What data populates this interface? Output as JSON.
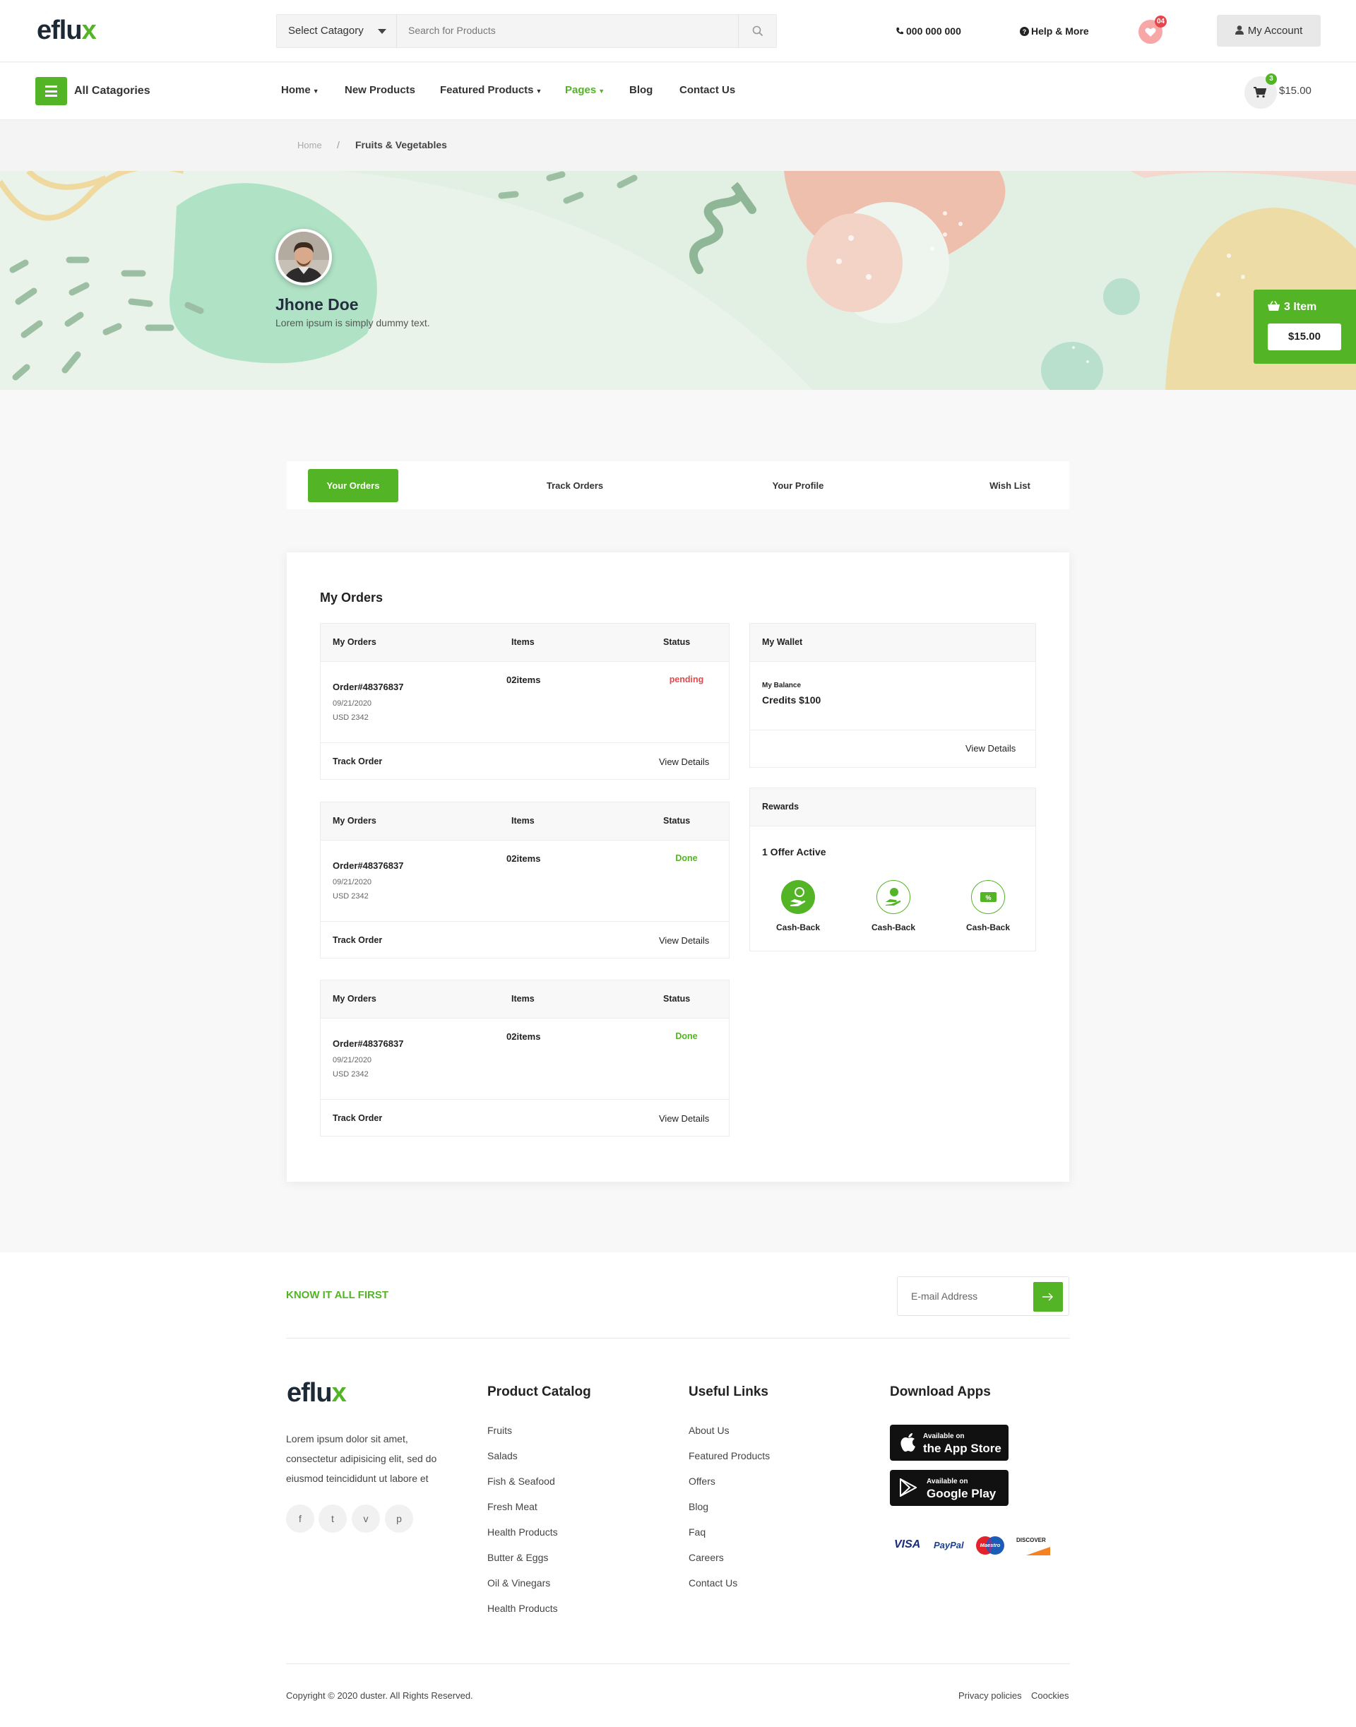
{
  "brand": {
    "logo_main": "eflu",
    "logo_accent": "x",
    "accent_color": "#53b426"
  },
  "header": {
    "category_select": "Select Catagory",
    "search_placeholder": "Search for Products",
    "phone": "000 000 000",
    "help": "Help & More",
    "wishlist_count": "04",
    "account": "My Account"
  },
  "nav": {
    "all_categories": "All Catagories",
    "items": [
      {
        "label": "Home",
        "dropdown": true
      },
      {
        "label": "New Products",
        "dropdown": false
      },
      {
        "label": "Featured Products",
        "dropdown": true
      },
      {
        "label": "Pages",
        "dropdown": true,
        "active": true
      },
      {
        "label": "Blog",
        "dropdown": false
      },
      {
        "label": "Contact Us",
        "dropdown": false
      }
    ],
    "cart_count": "3",
    "cart_total": "$15.00"
  },
  "breadcrumb": {
    "home": "Home",
    "separator": "/",
    "current": "Fruits & Vegetables"
  },
  "profile": {
    "name": "Jhone Doe",
    "tagline": "Lorem ipsum is simply dummy text."
  },
  "cart_widget": {
    "items": "3 Item",
    "total": "$15.00"
  },
  "tabs": [
    {
      "label": "Your Orders",
      "active": true
    },
    {
      "label": "Track Orders"
    },
    {
      "label": "Your Profile"
    },
    {
      "label": "Wish List"
    }
  ],
  "orders_section": {
    "title": "My Orders",
    "columns": [
      "My Orders",
      "Items",
      "Status"
    ],
    "orders": [
      {
        "number": "Order#48376837",
        "date": "09/21/2020",
        "amount": "USD 2342",
        "items": "02items",
        "status": "pending",
        "status_color": "#e4484c",
        "track": "Track Order",
        "details": "View Details"
      },
      {
        "number": "Order#48376837",
        "date": "09/21/2020",
        "amount": "USD 2342",
        "items": "02items",
        "status": "Done",
        "status_color": "#53b426",
        "track": "Track Order",
        "details": "View Details"
      },
      {
        "number": "Order#48376837",
        "date": "09/21/2020",
        "amount": "USD 2342",
        "items": "02items",
        "status": "Done",
        "status_color": "#53b426",
        "track": "Track Order",
        "details": "View Details"
      }
    ]
  },
  "wallet": {
    "title": "My Wallet",
    "balance_label": "My Balance",
    "balance": "Credits $100",
    "details": "View Details"
  },
  "rewards": {
    "title": "Rewards",
    "active": "1 Offer Active",
    "items": [
      {
        "label": "Cash-Back",
        "icon": "cash-back-icon",
        "filled": true
      },
      {
        "label": "Cash-Back",
        "icon": "hand-coin-icon",
        "filled": false
      },
      {
        "label": "Cash-Back",
        "icon": "voucher-icon",
        "filled": false
      }
    ]
  },
  "newsletter": {
    "heading": "KNOW IT ALL FIRST",
    "placeholder": "E-mail Address"
  },
  "footer": {
    "about": [
      "Lorem ipsum dolor sit amet,",
      "consectetur adipisicing elit, sed do",
      "eiusmod teincididunt ut labore et"
    ],
    "social": [
      "f",
      "t",
      "v",
      "p"
    ],
    "catalog": {
      "title": "Product Catalog",
      "links": [
        "Fruits",
        "Salads",
        "Fish & Seafood",
        "Fresh Meat",
        "Health Products",
        "Butter & Eggs",
        "Oil & Vinegars",
        "Health Products"
      ]
    },
    "useful": {
      "title": "Useful Links",
      "links": [
        "About Us",
        "Featured Products",
        "Offers",
        "Blog",
        "Faq",
        "Careers",
        "Contact Us"
      ]
    },
    "apps": {
      "title": "Download Apps",
      "app_store_top": "Available on",
      "app_store": "the App Store",
      "play_top": "Available on",
      "play": "Google Play",
      "payments": [
        "VISA",
        "PayPal",
        "Maestro",
        "DISCOVER"
      ]
    },
    "copyright": "Copyright © 2020 duster. All Rights Reserved.",
    "legal": [
      "Privacy policies",
      "Coockies"
    ]
  }
}
